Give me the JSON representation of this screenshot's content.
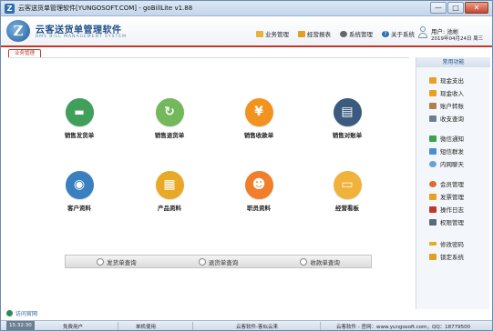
{
  "window": {
    "title": "云客送货单管理软件[YUNGOSOFT.COM] - goBillLite v1.88",
    "buttons": {
      "minimize": "—",
      "maximize": "□",
      "close": "✕"
    }
  },
  "header": {
    "logo_letter": "Z",
    "brand_cn": "云客送货单管理软件",
    "brand_en": "BMS BILL MANAGEMENT SYSTEM",
    "nav": [
      {
        "label": "业务管理",
        "icon": "folder-icon"
      },
      {
        "label": "经营报表",
        "icon": "report-icon"
      },
      {
        "label": "系统管理",
        "icon": "gear-icon"
      },
      {
        "label": "关于系统",
        "icon": "help-icon"
      }
    ],
    "user_line1": "用户: 池彬",
    "user_line2": "2019年04月24日 周三"
  },
  "tab": {
    "label": "业务管理"
  },
  "main": {
    "tiles": [
      {
        "label": "销售发货单",
        "icon": "delivery-truck-icon",
        "glyph": "🚚",
        "color": "#3f9f5b"
      },
      {
        "label": "销售退货单",
        "icon": "return-arrow-icon",
        "glyph": "↻",
        "color": "#73b85a"
      },
      {
        "label": "销售收款单",
        "icon": "yuan-icon",
        "glyph": "¥",
        "color": "#f2921f"
      },
      {
        "label": "销售对账单",
        "icon": "clipboard-icon",
        "glyph": "▤",
        "color": "#3a5b7d"
      },
      {
        "label": "客户资料",
        "icon": "customer-icon",
        "glyph": "◉",
        "color": "#3a7fc0"
      },
      {
        "label": "产品资料",
        "icon": "product-boxes-icon",
        "glyph": "▦",
        "color": "#e9a826"
      },
      {
        "label": "职员资料",
        "icon": "staff-icon",
        "glyph": "☻",
        "color": "#f07e2b"
      },
      {
        "label": "经营看板",
        "icon": "dashboard-icon",
        "glyph": "▭",
        "color": "#f0b23a"
      }
    ],
    "queries": [
      {
        "label": "发货单查询"
      },
      {
        "label": "退货单查询"
      },
      {
        "label": "收款单查询"
      }
    ]
  },
  "right_panel": {
    "title": "常用功能",
    "items": [
      {
        "label": "现金支出",
        "icon": "cash-out-icon",
        "color": "#e8a020"
      },
      {
        "label": "现金收入",
        "icon": "cash-in-icon",
        "color": "#e8a020"
      },
      {
        "label": "账户转账",
        "icon": "transfer-icon",
        "color": "#b08050"
      },
      {
        "label": "收支查询",
        "icon": "search-ledger-icon",
        "color": "#6b7f93"
      },
      {
        "label": "微信通知",
        "icon": "wechat-icon",
        "color": "#3aa34a"
      },
      {
        "label": "短信群发",
        "icon": "sms-icon",
        "color": "#4a8fd0"
      },
      {
        "label": "内网聊天",
        "icon": "chat-icon",
        "color": "#6aa0d8"
      },
      {
        "label": "会员管理",
        "icon": "member-icon",
        "color": "#e06a30"
      },
      {
        "label": "发票管理",
        "icon": "invoice-icon",
        "color": "#e8a020"
      },
      {
        "label": "操作日志",
        "icon": "log-icon",
        "color": "#c0392b"
      },
      {
        "label": "权限管理",
        "icon": "permission-icon",
        "color": "#5a6a7a"
      },
      {
        "label": "修改密码",
        "icon": "key-icon",
        "color": "#e0b020"
      },
      {
        "label": "锁定系统",
        "icon": "lock-icon",
        "color": "#e0a020"
      }
    ]
  },
  "footer": {
    "visit_label": "访问官网",
    "time": "15:32:30",
    "status": [
      "免费用户",
      "单机使用",
      "云客软件-客似云来",
      "云客软件 - 官网：www.yungosoft.com，QQ：18779500"
    ]
  }
}
